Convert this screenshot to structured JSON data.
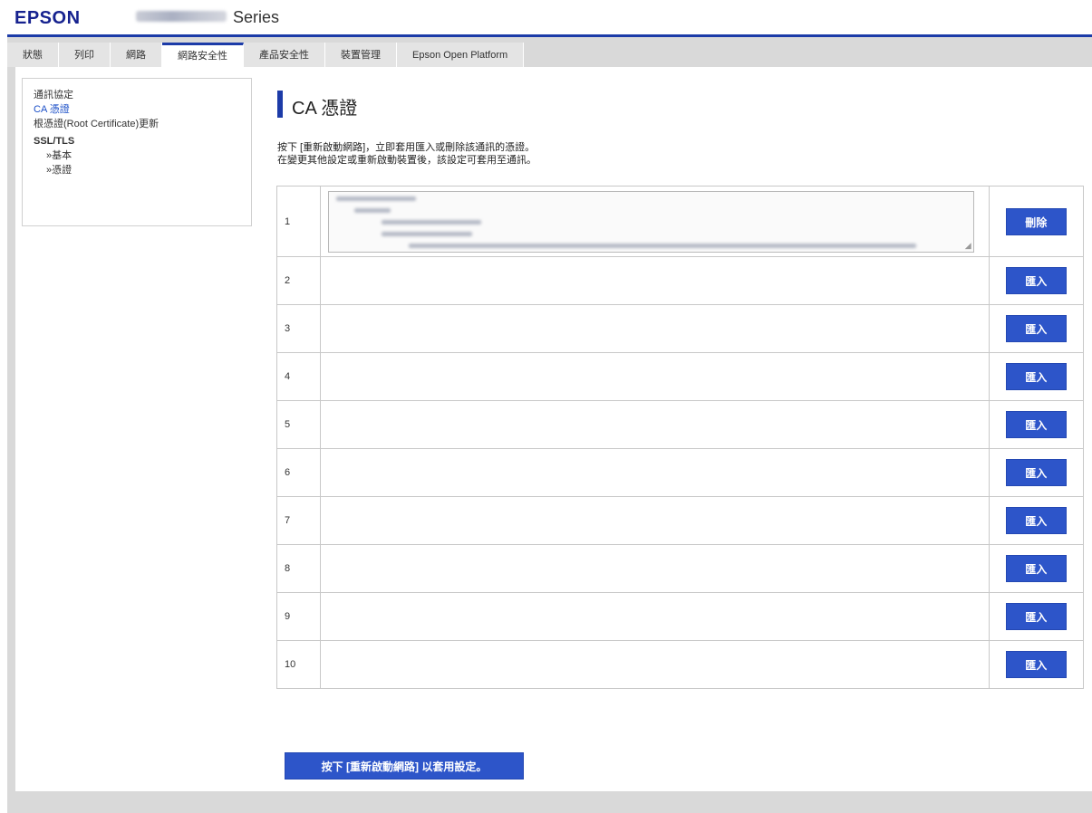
{
  "header": {
    "logo": "EPSON",
    "series": "Series"
  },
  "tabs": [
    {
      "label": "狀態"
    },
    {
      "label": "列印"
    },
    {
      "label": "網路"
    },
    {
      "label": "網路安全性"
    },
    {
      "label": "產品安全性"
    },
    {
      "label": "裝置管理"
    },
    {
      "label": "Epson Open Platform"
    }
  ],
  "sidebar": {
    "items": [
      {
        "label": "通訊協定"
      },
      {
        "label": "CA 憑證"
      },
      {
        "label": "根憑證(Root Certificate)更新"
      },
      {
        "label": "SSL/TLS"
      },
      {
        "label": "»基本"
      },
      {
        "label": "»憑證"
      }
    ]
  },
  "main": {
    "title": "CA 憑證",
    "description_line1": "按下 [重新啟動網路]，立即套用匯入或刪除該通訊的憑證。",
    "description_line2": "在變更其他設定或重新啟動裝置後，該設定可套用至通訊。"
  },
  "certificates": {
    "rows": [
      {
        "number": "1",
        "action": "刪除"
      },
      {
        "number": "2",
        "action": "匯入"
      },
      {
        "number": "3",
        "action": "匯入"
      },
      {
        "number": "4",
        "action": "匯入"
      },
      {
        "number": "5",
        "action": "匯入"
      },
      {
        "number": "6",
        "action": "匯入"
      },
      {
        "number": "7",
        "action": "匯入"
      },
      {
        "number": "8",
        "action": "匯入"
      },
      {
        "number": "9",
        "action": "匯入"
      },
      {
        "number": "10",
        "action": "匯入"
      }
    ]
  },
  "footer": {
    "apply_label": "按下 [重新啟動網路] 以套用設定。"
  },
  "colors": {
    "brand": "#16228f",
    "accent": "#1c3ba8",
    "button": "#2d55c9",
    "frame": "#d9d9d9",
    "link": "#1a4ec7"
  }
}
